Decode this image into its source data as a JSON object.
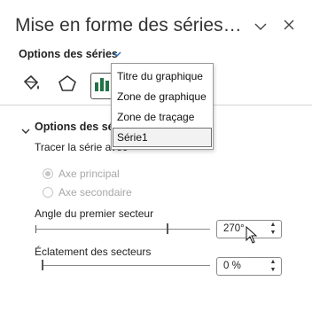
{
  "pane": {
    "title": "Mise en forme des séries…",
    "colors": {
      "accent": "#2f6fb5",
      "bar_green": "#217346"
    }
  },
  "options": {
    "label": "Options des séries"
  },
  "tabs": [
    {
      "icon": "fill-bucket-icon"
    },
    {
      "icon": "pentagon-icon"
    },
    {
      "icon": "bar-chart-icon",
      "selected": true
    }
  ],
  "dropdown": {
    "items": [
      "Titre du graphique",
      "Zone de graphique",
      "Zone de traçage",
      "Série1"
    ],
    "selected": "Série1"
  },
  "section": {
    "title": "Options des séries",
    "plot_on_label": "Tracer la série avec",
    "primary_axis": "Axe principal",
    "secondary_axis": "Axe secondaire"
  },
  "angle": {
    "label": "Angle du premier secteur",
    "value": "270°",
    "fraction": 0.75
  },
  "explosion": {
    "label": "Éclatement des secteurs",
    "value": "0 %",
    "fraction": 0
  }
}
